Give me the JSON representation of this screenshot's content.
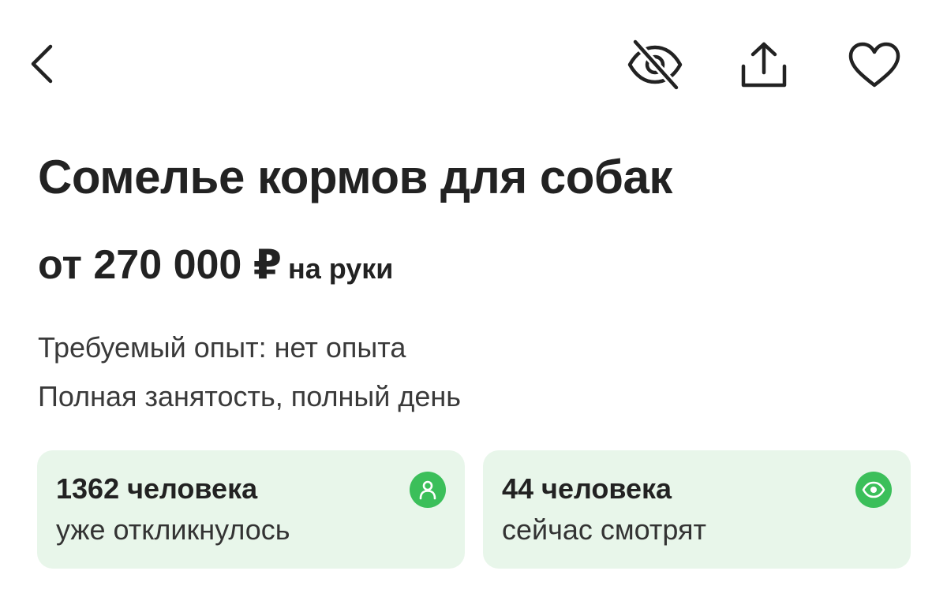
{
  "header": {
    "back_icon": "chevron-left-icon",
    "hide_icon": "eye-slash-icon",
    "share_icon": "share-upload-icon",
    "favorite_icon": "heart-outline-icon"
  },
  "vacancy": {
    "title": "Сомелье кормов для собак",
    "salary": "от 270 000 ₽",
    "salary_note": "на руки",
    "experience": "Требуемый опыт: нет опыта",
    "employment": "Полная занятость, полный день"
  },
  "stats": [
    {
      "count": "1362 человека",
      "label": "уже откликнулось",
      "icon": "person-icon"
    },
    {
      "count": "44 человека",
      "label": "сейчас смотрят",
      "icon": "eye-icon"
    }
  ],
  "colors": {
    "card_background": "#e8f6ea",
    "icon_badge": "#3bbf5a",
    "text_primary": "#222222"
  }
}
